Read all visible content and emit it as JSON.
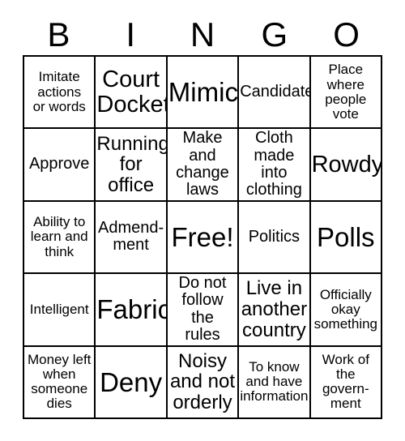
{
  "card": {
    "header_letters": [
      "B",
      "I",
      "N",
      "G",
      "O"
    ],
    "columns": 5,
    "rows": 5,
    "free_space_label": "Free!",
    "free_space_position": {
      "row": 3,
      "column": 3
    },
    "grid_line_color": "#000000",
    "background_color": "#ffffff",
    "text_color": "#000000",
    "cells": [
      {
        "text": "Imitate\nactions\nor words",
        "size": "sm"
      },
      {
        "text": "Court\nDocket",
        "size": "xl"
      },
      {
        "text": "Mimic",
        "size": "xxl"
      },
      {
        "text": "Candidate",
        "size": "md"
      },
      {
        "text": "Place\nwhere\npeople\nvote",
        "size": "sm"
      },
      {
        "text": "Approve",
        "size": "md"
      },
      {
        "text": "Running\nfor\noffice",
        "size": "lg"
      },
      {
        "text": "Make and\nchange\nlaws",
        "size": "md"
      },
      {
        "text": "Cloth\nmade into\nclothing",
        "size": "md"
      },
      {
        "text": "Rowdy",
        "size": "xl"
      },
      {
        "text": "Ability to\nlearn and\nthink",
        "size": "sm"
      },
      {
        "text": "Admend-\nment",
        "size": "md"
      },
      {
        "text": "Free!",
        "size": "xxl"
      },
      {
        "text": "Politics",
        "size": "md"
      },
      {
        "text": "Polls",
        "size": "xxl"
      },
      {
        "text": "Intelligent",
        "size": "sm"
      },
      {
        "text": "Fabric",
        "size": "xxl"
      },
      {
        "text": "Do not\nfollow the\nrules",
        "size": "md"
      },
      {
        "text": "Live in\nanother\ncountry",
        "size": "lg"
      },
      {
        "text": "Officially\nokay\nsomething",
        "size": "sm"
      },
      {
        "text": "Money left\nwhen\nsomeone\ndies",
        "size": "sm"
      },
      {
        "text": "Deny",
        "size": "xxl"
      },
      {
        "text": "Noisy\nand not\norderly",
        "size": "lg"
      },
      {
        "text": "To know\nand have\ninformation",
        "size": "sm"
      },
      {
        "text": "Work of\nthe\ngovern-\nment",
        "size": "sm"
      }
    ]
  }
}
